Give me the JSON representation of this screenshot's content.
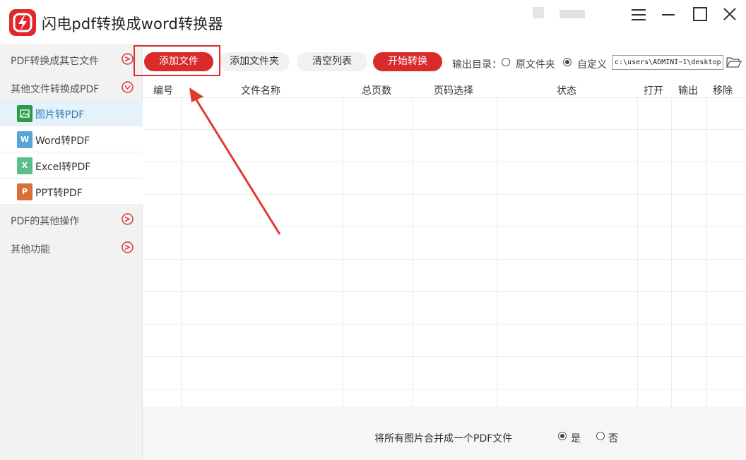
{
  "window": {
    "title": "闪电pdf转换成word转换器"
  },
  "sidebar": {
    "groups": [
      {
        "label": "PDF转换成其它文件",
        "expanded": false
      },
      {
        "label": "其他文件转换成PDF",
        "expanded": true
      },
      {
        "label": "PDF的其他操作",
        "expanded": false
      },
      {
        "label": "其他功能",
        "expanded": false
      }
    ],
    "items": [
      {
        "label": "图片转PDF",
        "icon": "image-file-icon",
        "active": true
      },
      {
        "label": "Word转PDF",
        "icon": "word-file-icon",
        "icon_letter": "W",
        "active": false
      },
      {
        "label": "Excel转PDF",
        "icon": "excel-file-icon",
        "icon_letter": "X",
        "active": false
      },
      {
        "label": "PPT转PDF",
        "icon": "ppt-file-icon",
        "icon_letter": "P",
        "active": false
      }
    ]
  },
  "toolbar": {
    "add_file": "添加文件",
    "add_folder": "添加文件夹",
    "clear_list": "清空列表",
    "start_convert": "开始转换",
    "output_dir_label": "输出目录：",
    "original_folder": "原文件夹",
    "custom": "自定义",
    "output_choice": "自定义",
    "output_path": "c:\\users\\ADMINI~1\\desktop"
  },
  "table": {
    "columns": [
      "编号",
      "文件名称",
      "总页数",
      "页码选择",
      "状态",
      "打开",
      "输出",
      "移除"
    ],
    "rows": []
  },
  "footer": {
    "merge_label": "将所有图片合并成一个PDF文件",
    "yes": "是",
    "no": "否",
    "merge_choice": "是"
  },
  "colors": {
    "accent_red": "#d92a2c",
    "active_item_bg": "#e5f2fa",
    "active_item_text": "#2c7fb8",
    "word_icon": "#5aa3d8",
    "excel_icon": "#5bbf8a",
    "ppt_icon": "#d9703a",
    "image_icon": "#2f9a4a"
  }
}
